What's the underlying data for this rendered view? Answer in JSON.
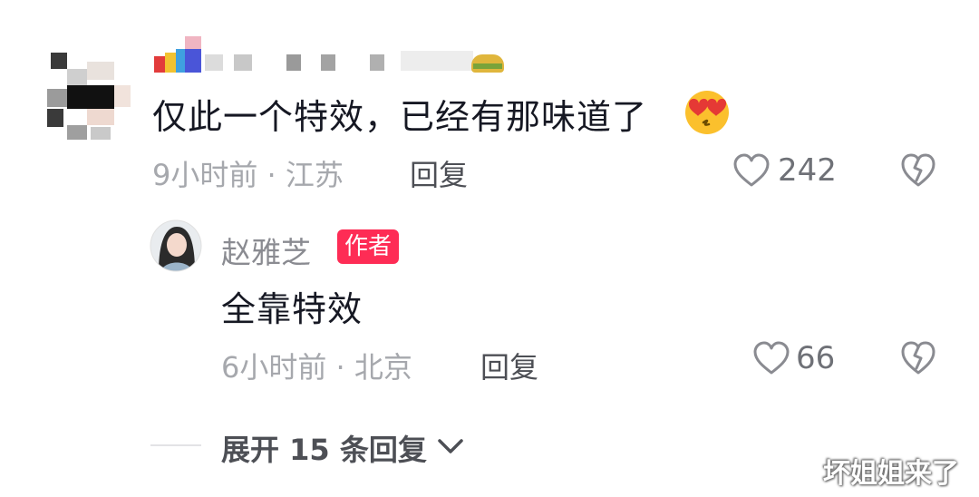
{
  "comment": {
    "text": "仅此一个特效，已经有那味道了",
    "emoji": "heart-eyes-kiss-emoji",
    "time": "9小时前",
    "location": "江苏",
    "reply_label": "回复",
    "likes": "242"
  },
  "reply": {
    "username": "赵雅芝",
    "badge": "作者",
    "text": "全靠特效",
    "time": "6小时前",
    "location": "北京",
    "reply_label": "回复",
    "likes": "66"
  },
  "expand": {
    "label": "展开 15 条回复"
  },
  "meta_separator": "·",
  "watermark": "坏姐姐来了",
  "colors": {
    "badge": "#fe2c55",
    "primary_text": "#161823",
    "secondary_text": "#a6a8ad"
  }
}
